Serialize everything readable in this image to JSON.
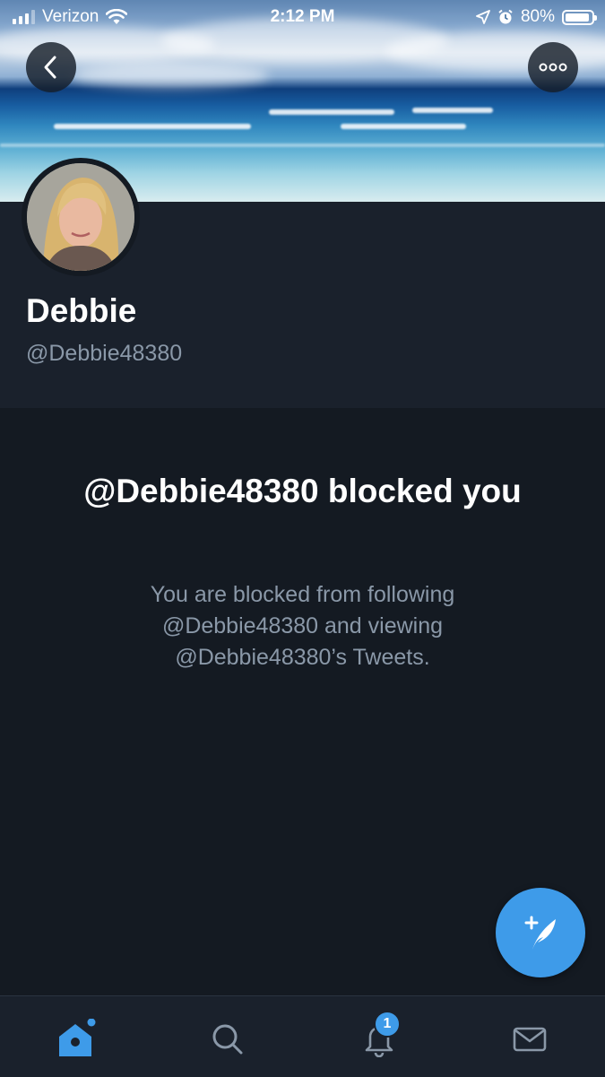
{
  "status_bar": {
    "carrier": "Verizon",
    "time": "2:12 PM",
    "battery": "80%",
    "battery_level": 0.8
  },
  "header": {
    "back_icon": "chevron-left-icon",
    "more_icon": "more-horizontal-icon"
  },
  "profile": {
    "name": "Debbie",
    "handle": "@Debbie48380"
  },
  "blocked_notice": {
    "title": "@Debbie48380 blocked you",
    "message": "You are blocked from following @Debbie48380 and viewing @Debbie48380’s Tweets."
  },
  "compose": {
    "icon": "compose-tweet-icon"
  },
  "tab_bar": {
    "tabs": [
      {
        "name": "home",
        "icon": "home-icon",
        "active": true
      },
      {
        "name": "search",
        "icon": "search-icon",
        "active": false
      },
      {
        "name": "notifications",
        "icon": "bell-icon",
        "active": false,
        "badge": "1"
      },
      {
        "name": "messages",
        "icon": "mail-icon",
        "active": false
      }
    ]
  },
  "colors": {
    "accent": "#3e9be9",
    "background": "#141a22",
    "surface": "#1a212c",
    "secondary_text": "#8a98a8"
  }
}
